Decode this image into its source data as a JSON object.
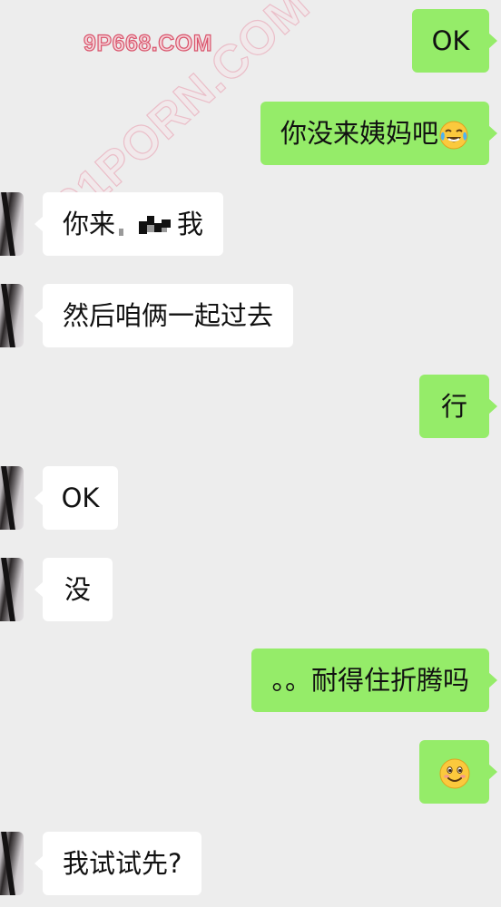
{
  "watermarks": {
    "top": "9P668.COM",
    "diagonal": "91PORN.COM"
  },
  "messages": [
    {
      "side": "out",
      "text": "OK"
    },
    {
      "side": "out",
      "text": "你没来姨妈吧",
      "emoji": "laughing-crying-emoji"
    },
    {
      "side": "in",
      "text_before": "你来",
      "redacted": true,
      "text_after": "我"
    },
    {
      "side": "in",
      "text": "然后咱俩一起过去"
    },
    {
      "side": "out",
      "text": "行"
    },
    {
      "side": "in",
      "text": "OK"
    },
    {
      "side": "in",
      "text": "没"
    },
    {
      "side": "out",
      "text": "。。耐得住折腾吗"
    },
    {
      "side": "out",
      "text": "",
      "emoji": "smiling-emoji"
    },
    {
      "side": "in",
      "text": "我试试先?"
    }
  ],
  "colors": {
    "background": "#ededed",
    "outgoing_bubble": "#95ec69",
    "incoming_bubble": "#ffffff"
  }
}
